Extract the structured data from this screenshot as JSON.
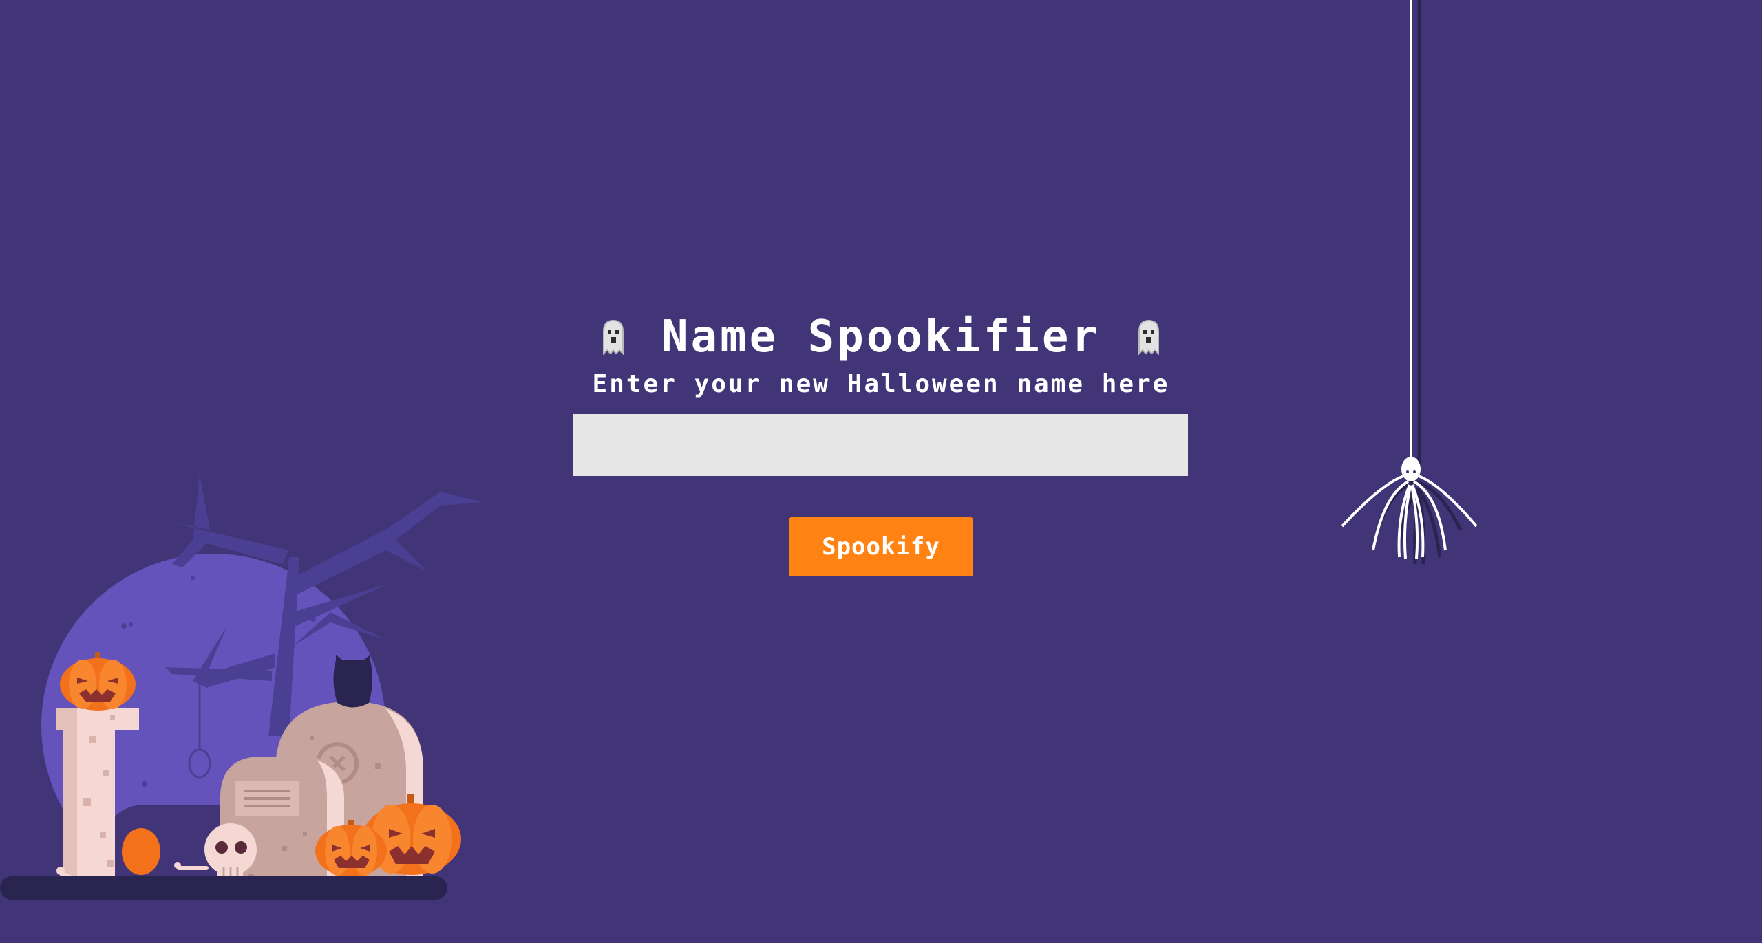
{
  "app": {
    "title": "Name Spookifier",
    "subtitle": "Enter your new Halloween name here"
  },
  "form": {
    "name_input": {
      "value": "",
      "placeholder": ""
    },
    "submit_label": "Spookify"
  },
  "icons": {
    "left": "ghost-icon",
    "right": "ghost-icon",
    "decoration_right": "spider-icon",
    "decoration_left": "graveyard-illustration"
  },
  "colors": {
    "background": "#413578",
    "accent": "#ff8213",
    "input_background": "#e6e6e6",
    "text": "#ffffff",
    "moon": "#6553bc",
    "pumpkin": "#f4711c"
  }
}
